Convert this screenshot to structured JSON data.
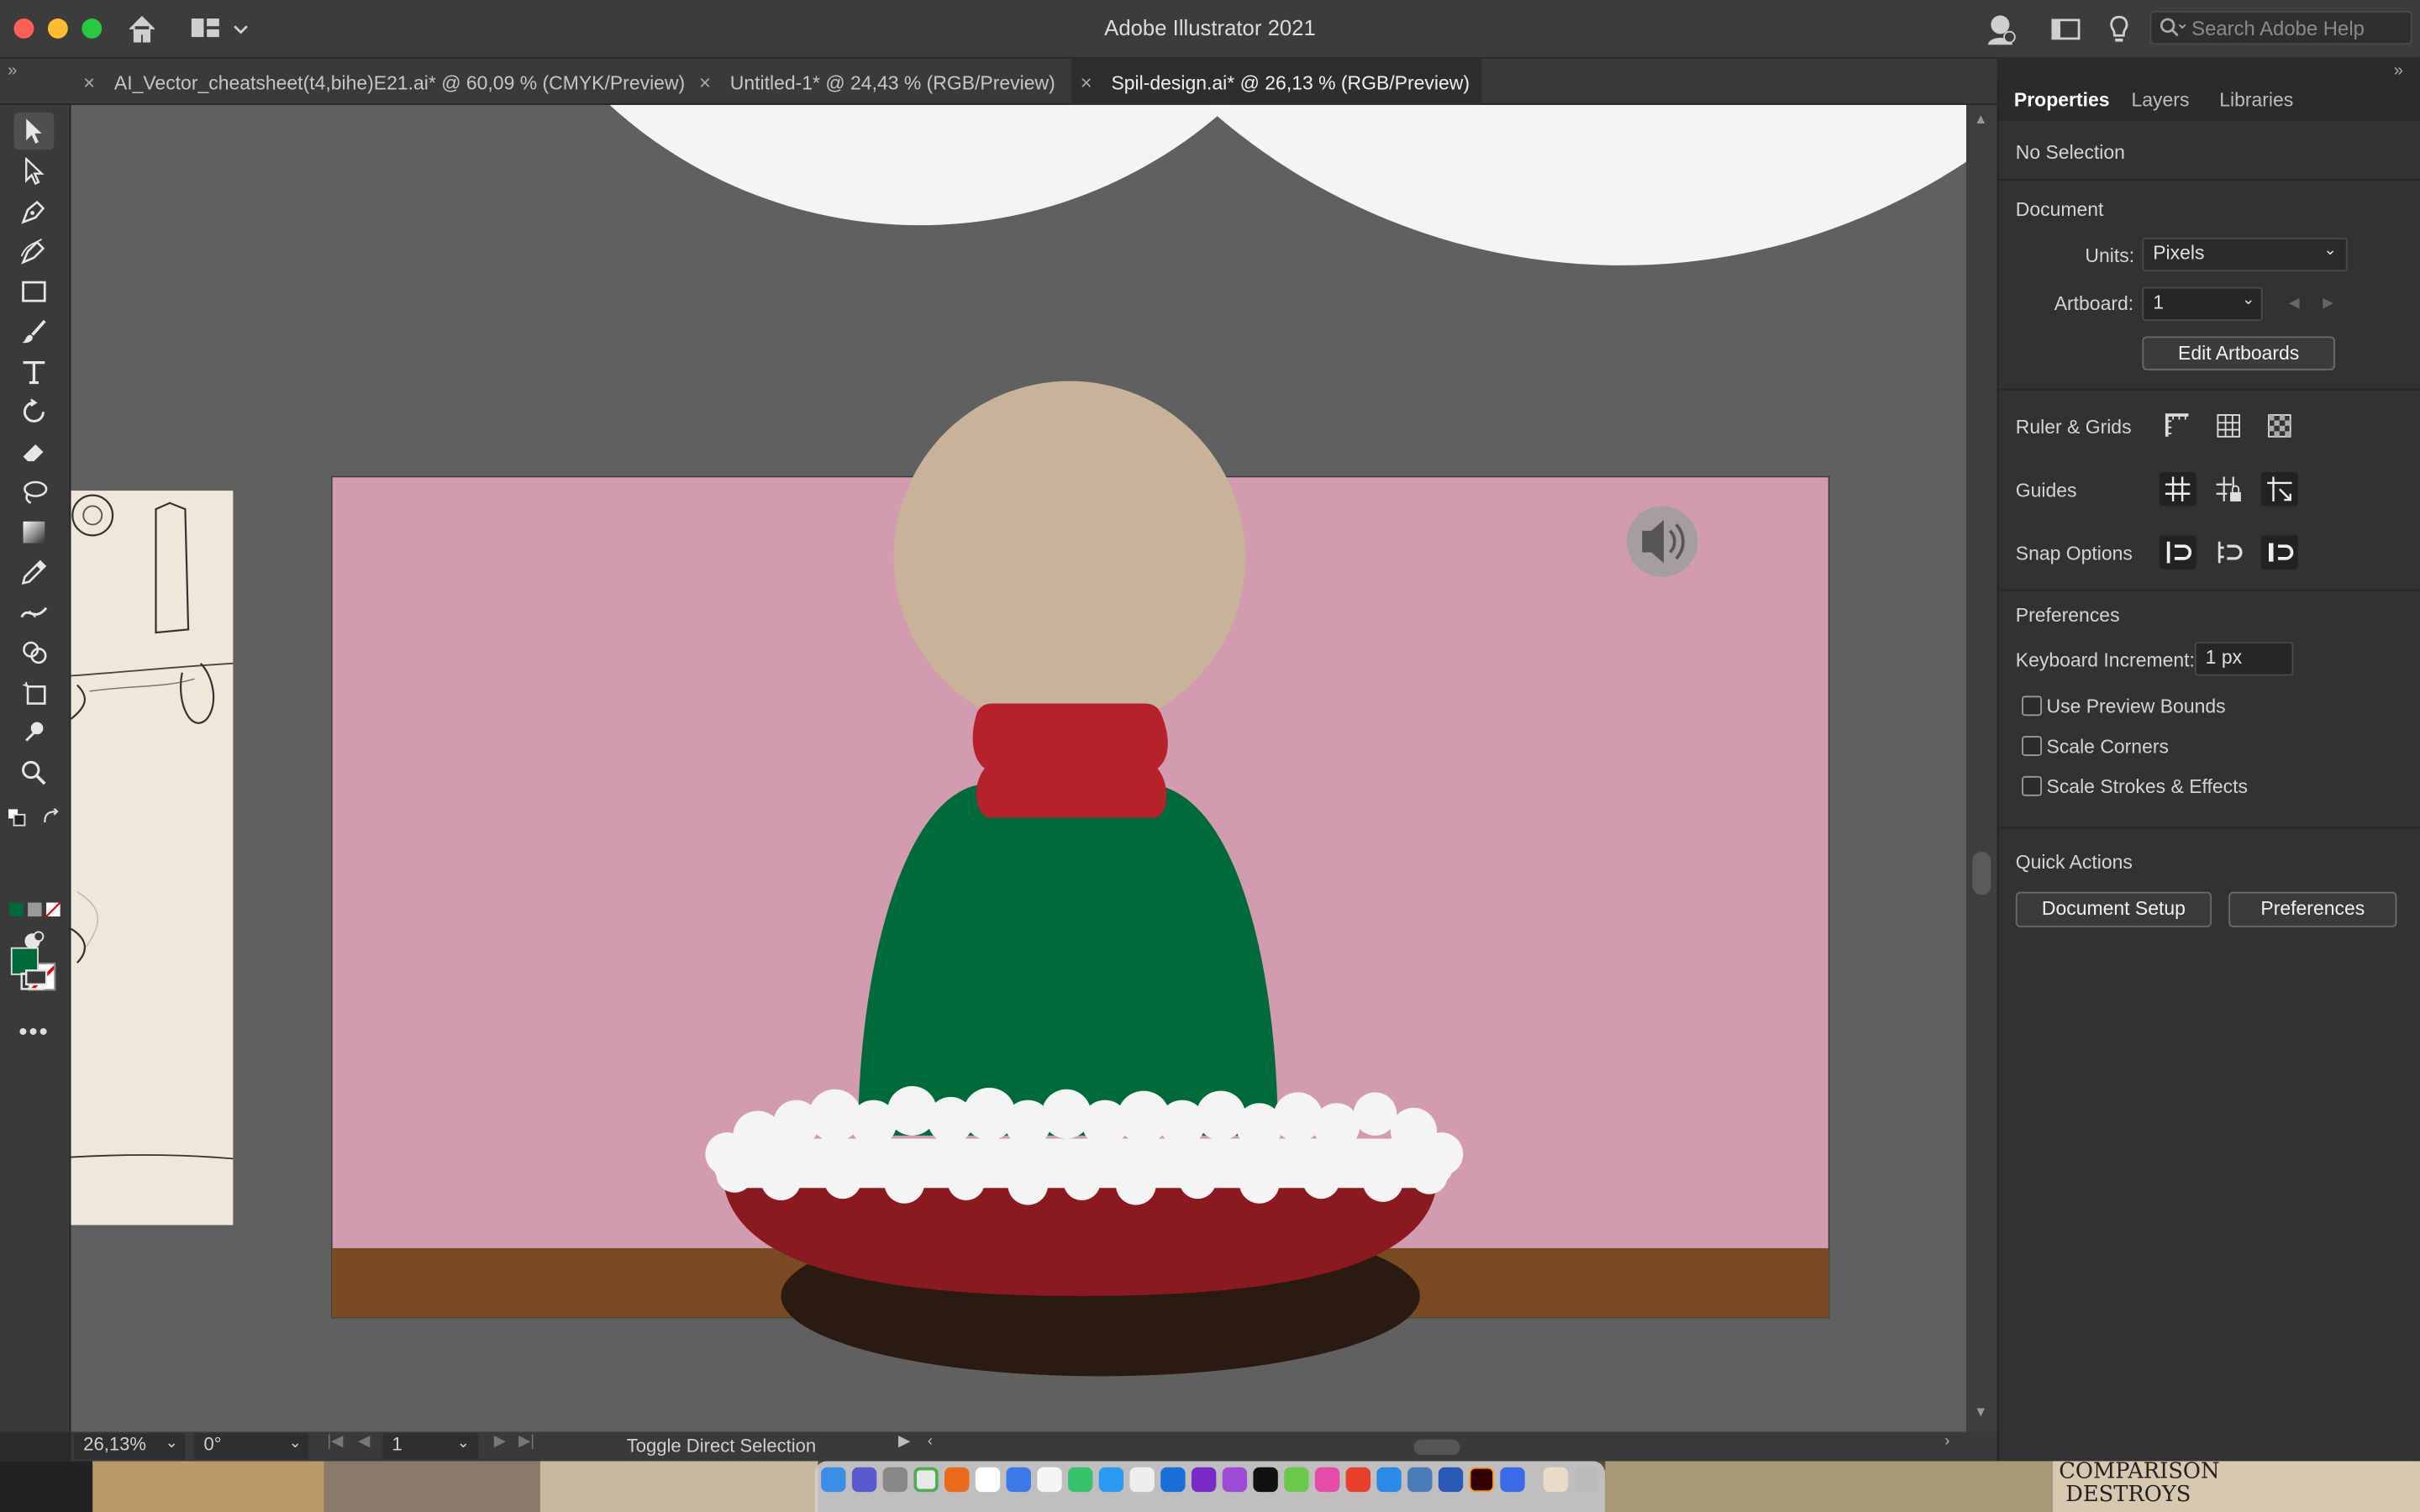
{
  "app": {
    "title": "Adobe Illustrator 2021",
    "search_placeholder": "Search Adobe Help"
  },
  "tabs": [
    {
      "label": "AI_Vector_cheatsheet(t4,bihe)E21.ai* @ 60,09 % (CMYK/Preview)",
      "active": false
    },
    {
      "label": "Untitled-1* @ 24,43 % (RGB/Preview)",
      "active": false
    },
    {
      "label": "Spil-design.ai* @ 26,13 % (RGB/Preview)",
      "active": true
    }
  ],
  "tools": [
    "selection-tool",
    "direct-selection-tool",
    "pen-tool",
    "curvature-tool",
    "rectangle-tool",
    "paintbrush-tool",
    "type-tool",
    "rotate-tool",
    "eraser-tool",
    "lasso-tool",
    "gradient-tool",
    "eyedropper-tool",
    "width-tool",
    "shape-builder-tool",
    "artboard-tool",
    "puppet-warp-tool",
    "zoom-tool"
  ],
  "colors": {
    "fill": "#00693a",
    "artboard": "#d29bb0",
    "floor": "#7a4b22",
    "head": "#c8b29a",
    "scarf": "#b5222b",
    "body": "#006b3a",
    "fur": "#f4f4f4",
    "dish": "#8b1a20",
    "shadow": "#2a1a12",
    "pasteboard": "#606060"
  },
  "status": {
    "zoom": "26,13%",
    "rotation": "0°",
    "artboard_number": "1",
    "message": "Toggle Direct Selection"
  },
  "panel": {
    "tabs": [
      "Properties",
      "Layers",
      "Libraries"
    ],
    "selection": "No Selection",
    "document_heading": "Document",
    "units_label": "Units:",
    "units_value": "Pixels",
    "artboard_label": "Artboard:",
    "artboard_value": "1",
    "edit_artboards": "Edit Artboards",
    "ruler_grids": "Ruler & Grids",
    "guides": "Guides",
    "snap_options": "Snap Options",
    "preferences_heading": "Preferences",
    "keyboard_increment_label": "Keyboard Increment:",
    "keyboard_increment_value": "1 px",
    "use_preview_bounds": "Use Preview Bounds",
    "scale_corners": "Scale Corners",
    "scale_strokes": "Scale Strokes & Effects",
    "quick_actions": "Quick Actions",
    "document_setup": "Document Setup",
    "preferences_button": "Preferences"
  },
  "background_poster_text": "COMPARISON DESTROYS"
}
